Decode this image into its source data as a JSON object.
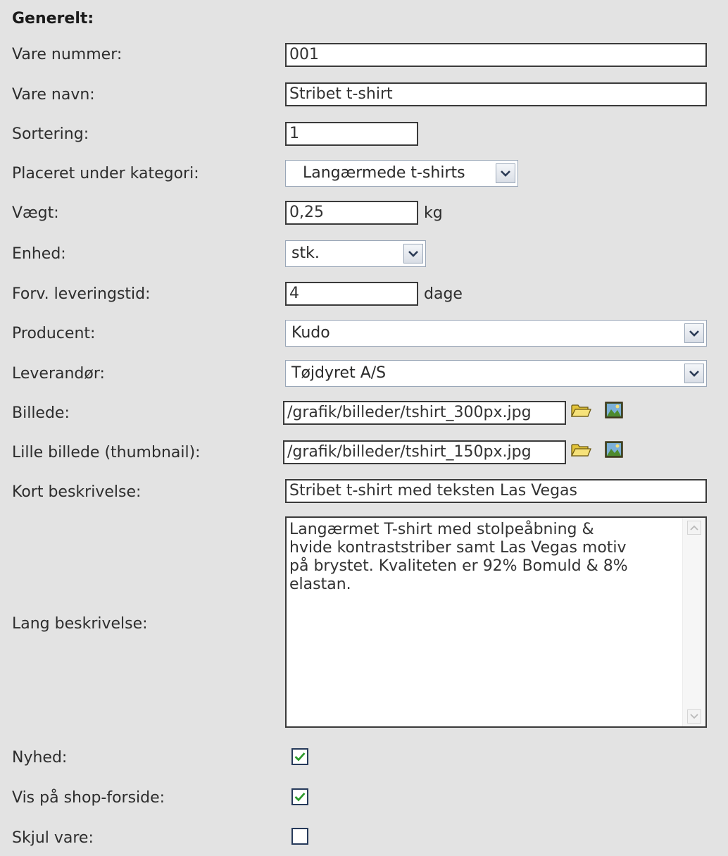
{
  "section_title": "Generelt:",
  "fields": {
    "vare_nummer": {
      "label": "Vare nummer:",
      "value": "001"
    },
    "vare_navn": {
      "label": "Vare navn:",
      "value": "Stribet t-shirt"
    },
    "sortering": {
      "label": "Sortering:",
      "value": "1"
    },
    "kategori": {
      "label": "Placeret under kategori:",
      "value": "Langærmede t-shirts"
    },
    "vaegt": {
      "label": "Vægt:",
      "value": "0,25",
      "unit": "kg"
    },
    "enhed": {
      "label": "Enhed:",
      "value": "stk."
    },
    "leveringstid": {
      "label": "Forv. leveringstid:",
      "value": "4",
      "unit": "dage"
    },
    "producent": {
      "label": "Producent:",
      "value": "Kudo"
    },
    "leverandoer": {
      "label": "Leverandør:",
      "value": "Tøjdyret A/S"
    },
    "billede": {
      "label": "Billede:",
      "value": "/grafik/billeder/tshirt_300px.jpg"
    },
    "thumbnail": {
      "label": "Lille billede (thumbnail):",
      "value": "/grafik/billeder/tshirt_150px.jpg"
    },
    "kort_beskrivelse": {
      "label": "Kort beskrivelse:",
      "value": "Stribet t-shirt med teksten Las Vegas"
    },
    "lang_beskrivelse": {
      "label": "Lang beskrivelse:",
      "value": "Langærmet T-shirt med stolpeåbning &\nhvide kontraststriber samt Las Vegas motiv\npå brystet. Kvaliteten er 92% Bomuld & 8%\nelastan."
    },
    "nyhed": {
      "label": "Nyhed:",
      "checked": true
    },
    "vis_forside": {
      "label": "Vis på shop-forside:",
      "checked": true
    },
    "skjul_vare": {
      "label": "Skjul vare:",
      "checked": false
    }
  },
  "icons": {
    "browse": "folder-icon",
    "preview": "image-preview-icon",
    "dropdown": "chevron-down-icon",
    "checkmark": "checkmark-icon"
  },
  "colors": {
    "background": "#e3e3e3",
    "check": "#2c9a2c",
    "select_border": "#9aa7b8"
  }
}
